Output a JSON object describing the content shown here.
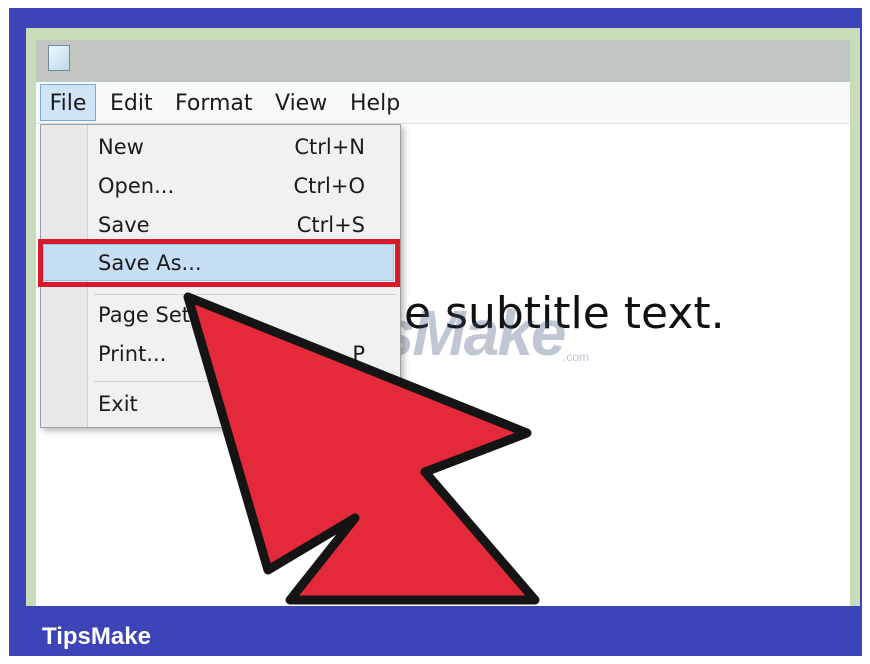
{
  "menubar": {
    "items": [
      "File",
      "Edit",
      "Format",
      "View",
      "Help"
    ]
  },
  "file_menu": {
    "items": [
      {
        "label": "New",
        "shortcut": "Ctrl+N"
      },
      {
        "label": "Open...",
        "shortcut": "Ctrl+O"
      },
      {
        "label": "Save",
        "shortcut": "Ctrl+S"
      },
      {
        "label": "Save As...",
        "shortcut": ""
      },
      {
        "label": "Page Set",
        "shortcut": ""
      },
      {
        "label": "Print...",
        "shortcut": "P"
      },
      {
        "label": "Exit",
        "shortcut": ""
      }
    ],
    "highlighted": "Save As..."
  },
  "document": {
    "visible_text": "e subtitle text."
  },
  "watermark": {
    "text": "TipsMake",
    "suffix": ".com"
  },
  "footer": {
    "brand": "TipsMake"
  },
  "colors": {
    "frame": "#3c44b8",
    "highlight_box": "#d6192b",
    "arrow": "#e42a3a",
    "menu_highlight": "#c7dff4"
  },
  "icons": {
    "app": "notepad-icon",
    "pointer": "red-arrow-icon"
  }
}
